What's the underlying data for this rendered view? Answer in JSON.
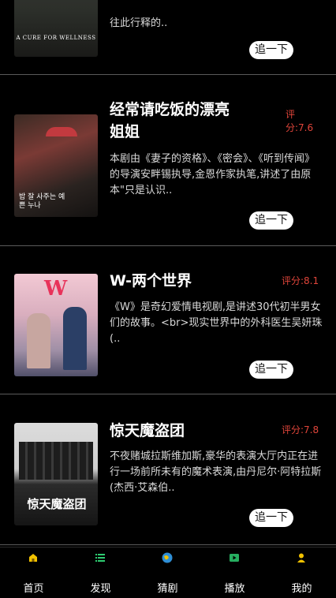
{
  "feed": {
    "items": [
      {
        "title": "",
        "rating": "",
        "description": "往此行释的..",
        "poster_text": "A CURE FOR WELLNESS",
        "button": "追一下"
      },
      {
        "title": "经常请吃饭的漂亮姐姐",
        "rating": "评分:7.6",
        "description": "本剧由《妻子的资格》、《密会》、《听到传闻》的导演安畔锡执导,金恩作家执笔,讲述了由原本\"只是认识..",
        "poster_text": "밥 잘 사주는 예쁜 누나",
        "button": "追一下"
      },
      {
        "title": "W-两个世界",
        "rating": "评分:8.1",
        "description": "《W》是奇幻爱情电视剧,是讲述30代初半男女们的故事。<br>现实世界中的外科医生吴妍珠(..",
        "poster_text": "W",
        "button": "追一下"
      },
      {
        "title": "惊天魔盗团",
        "rating": "评分:7.8",
        "description": "不夜赌城拉斯维加斯,豪华的表演大厅内正在进行一场前所未有的魔术表演,由丹尼尔·阿特拉斯(杰西·艾森伯..",
        "poster_text": "惊天魔盗团",
        "button": "追一下"
      }
    ]
  },
  "tabbar": {
    "items": [
      {
        "label": "首页",
        "icon": "home-icon"
      },
      {
        "label": "发现",
        "icon": "list-icon"
      },
      {
        "label": "猜剧",
        "icon": "globe-icon"
      },
      {
        "label": "播放",
        "icon": "play-icon"
      },
      {
        "label": "我的",
        "icon": "user-icon"
      }
    ]
  },
  "colors": {
    "background": "#000000",
    "rating": "#e0453a",
    "tab_icon": "#f2c200",
    "tab_icon_green": "#2ecc71"
  }
}
